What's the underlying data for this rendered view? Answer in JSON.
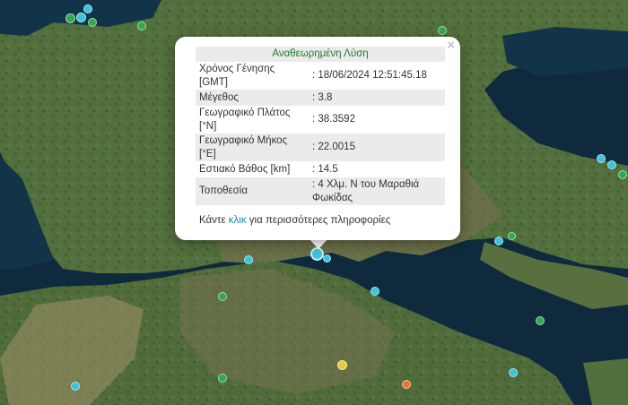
{
  "popup": {
    "header": "Αναθεωρημένη Λύση",
    "close_glyph": "×",
    "rows": [
      {
        "label": "Χρόνος Γένησης [GMT]",
        "value": ": 18/06/2024 12:51:45.18"
      },
      {
        "label": "Μέγεθος",
        "value": ": 3.8"
      },
      {
        "label": "Γεωγραφικό Πλάτος [°N]",
        "value": ": 38.3592"
      },
      {
        "label": "Γεωγραφικό Μήκος [°E]",
        "value": ": 22.0015"
      },
      {
        "label": "Εστιακό Βάθος [km]",
        "value": ": 14.5"
      },
      {
        "label": "Τοποθεσία",
        "value": ": 4 Χλμ. Ν του Μαραθιά Φωκίδας"
      }
    ],
    "more_prefix": "Κάντε ",
    "more_link": "κλικ",
    "more_suffix": " για περισσότερες πληροφορίες"
  },
  "colors": {
    "sea": "#0f2a3d",
    "land_green": "#4e6b3a",
    "land_brown": "#8a7a58",
    "marker_cyan": "#3cc4dc",
    "marker_green": "#32a852",
    "marker_yellow": "#e8c83a",
    "marker_orange": "#e8742a",
    "header_green": "#1f7a2f",
    "link_blue": "#1a8ab5"
  }
}
